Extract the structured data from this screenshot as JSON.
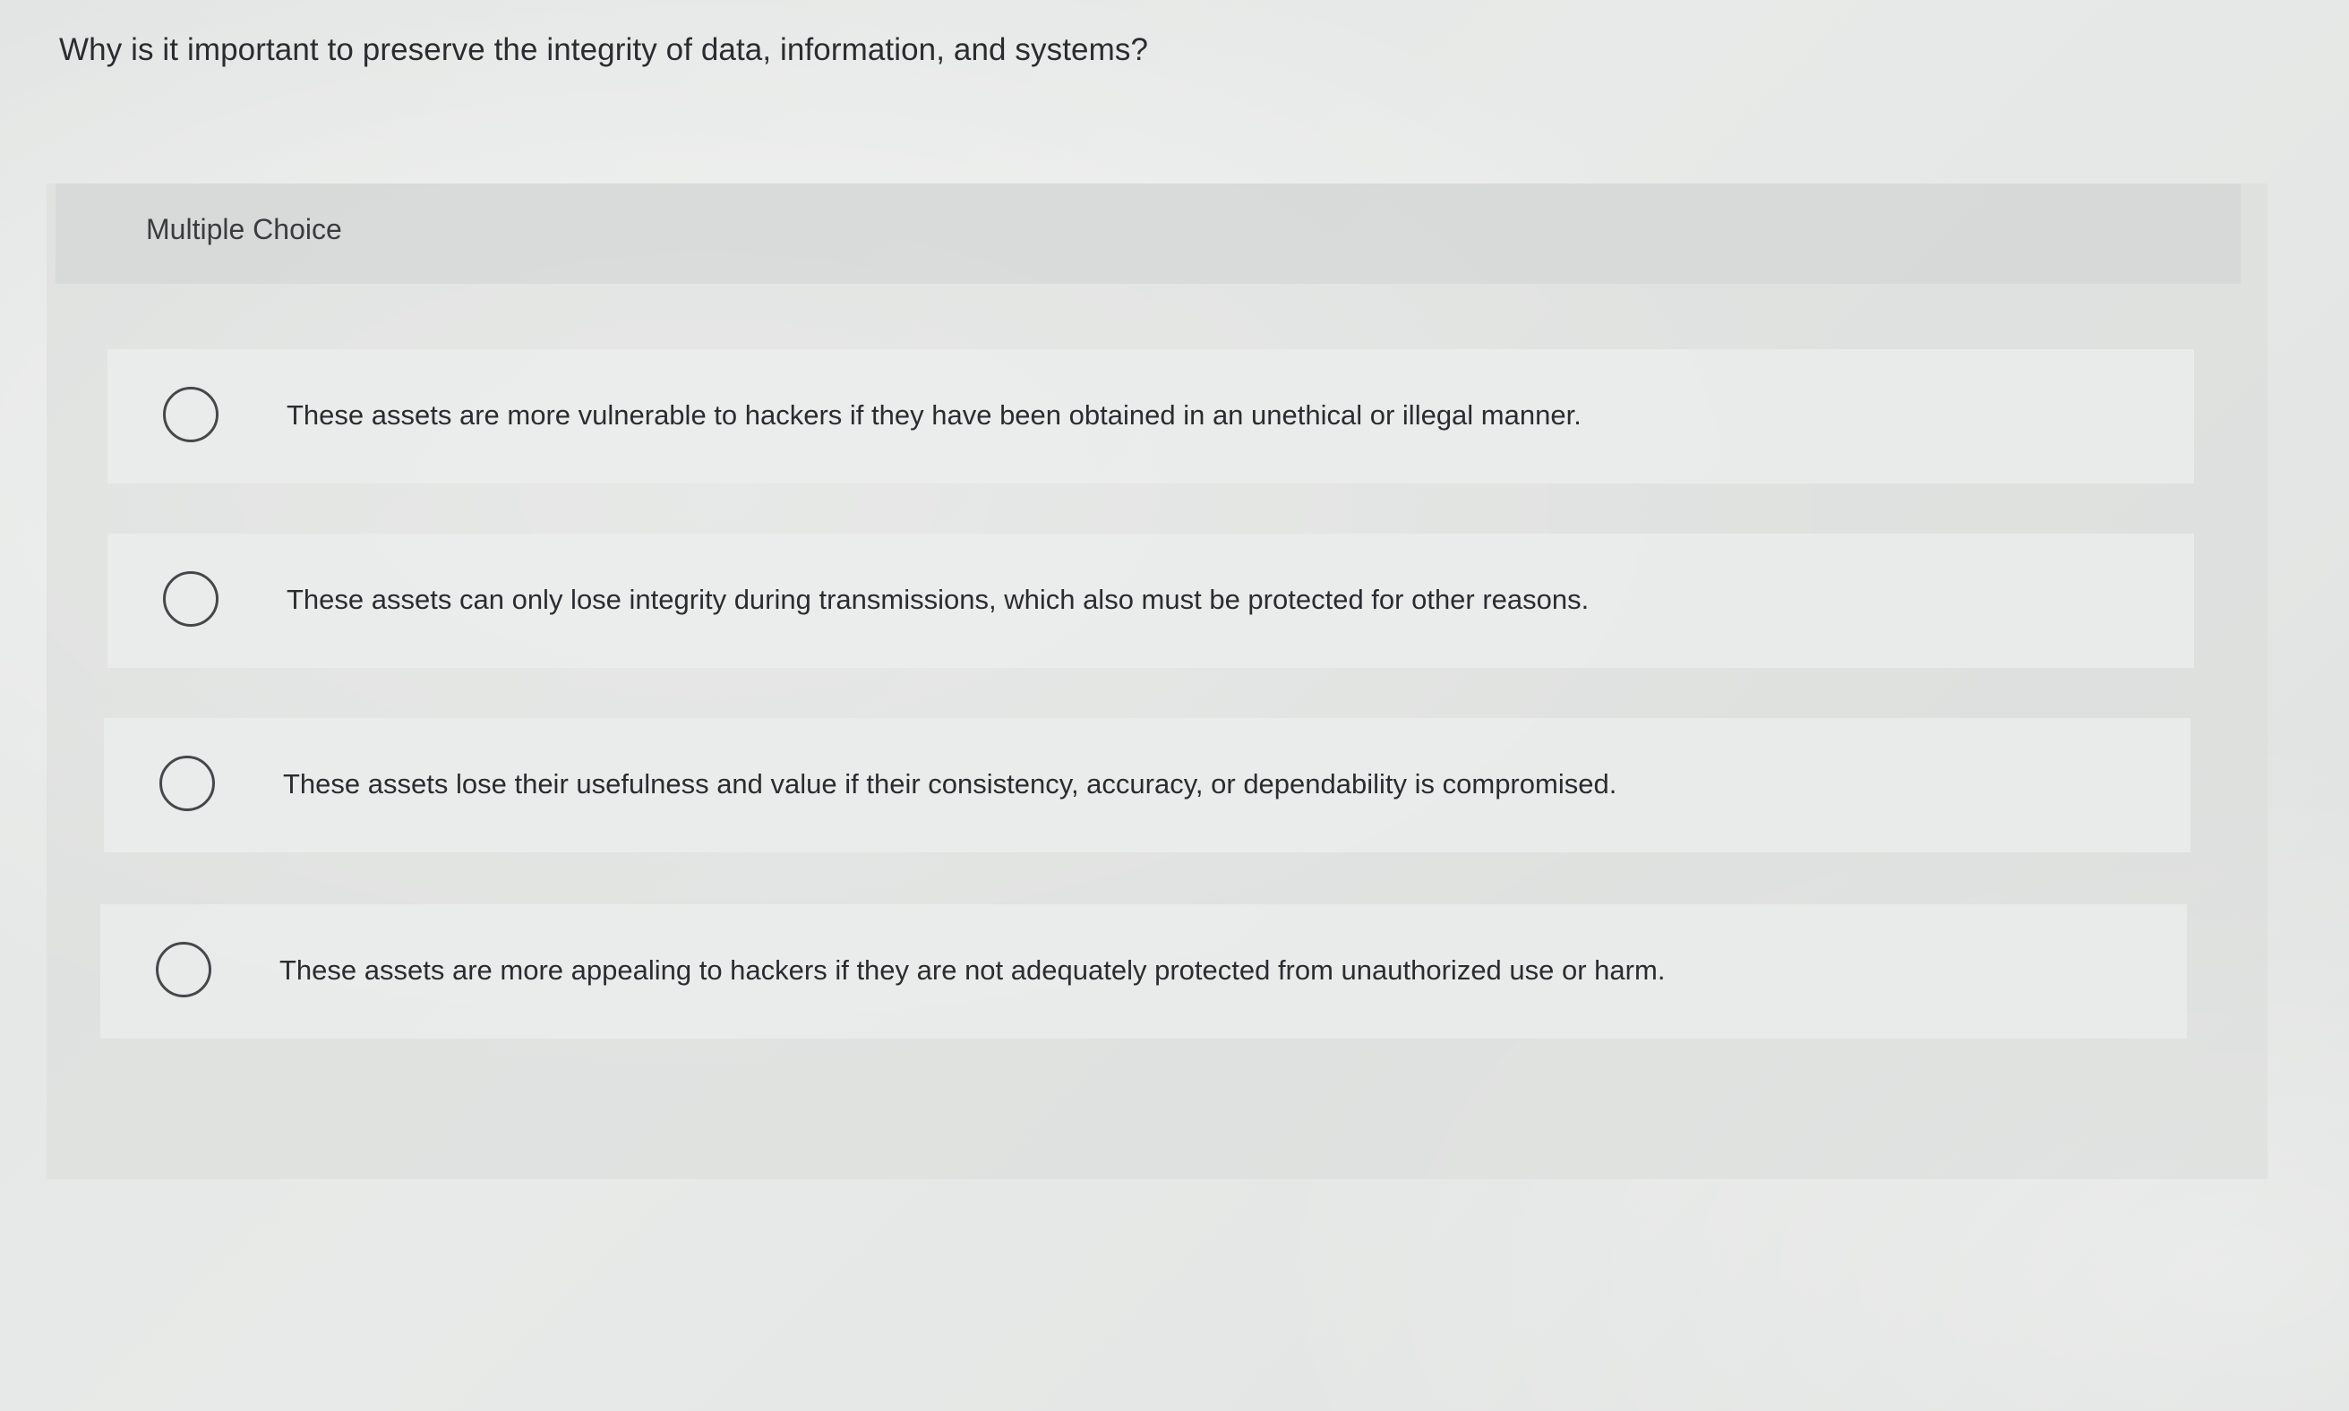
{
  "question": {
    "text": "Why is it important to preserve the integrity of data, information, and systems?"
  },
  "section": {
    "label": "Multiple Choice"
  },
  "options": [
    {
      "text": "These assets are more vulnerable to hackers if they have been obtained in an unethical or illegal manner.",
      "selected": false
    },
    {
      "text": "These assets can only lose integrity during transmissions, which also must be protected for other reasons.",
      "selected": false
    },
    {
      "text": "These assets lose their usefulness and value if their consistency, accuracy, or dependability is compromised.",
      "selected": false
    },
    {
      "text": "These assets are more appealing to hackers if they are not adequately protected from unauthorized use or harm.",
      "selected": false
    }
  ]
}
